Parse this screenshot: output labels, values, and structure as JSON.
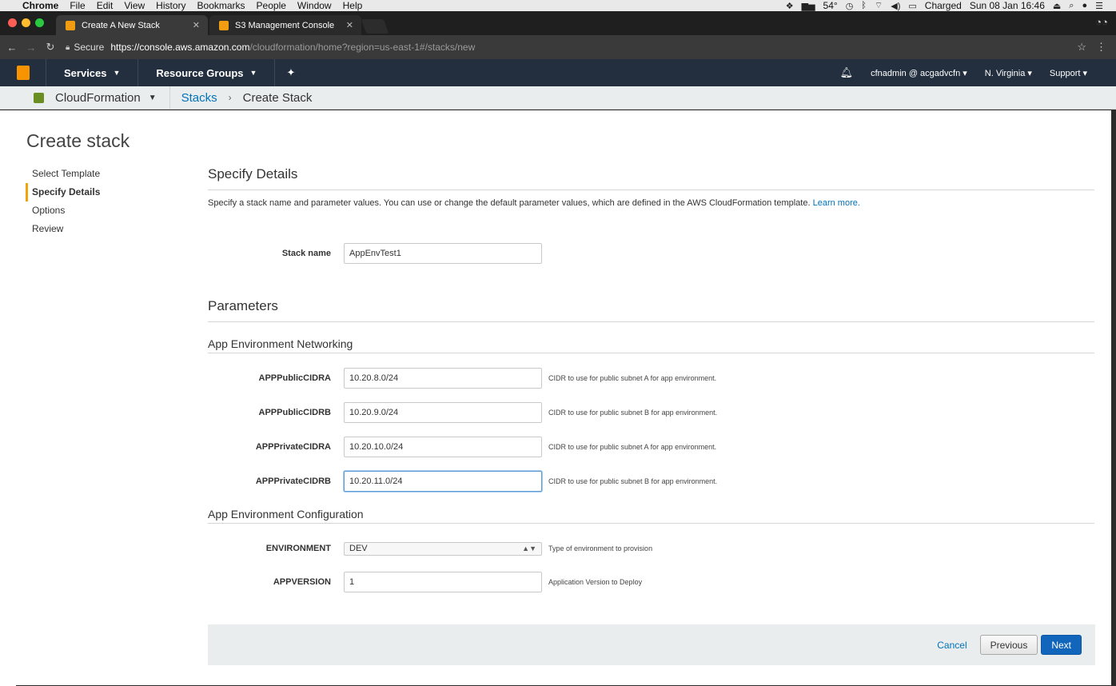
{
  "mac_menu": {
    "app": "Chrome",
    "items": [
      "File",
      "Edit",
      "View",
      "History",
      "Bookmarks",
      "People",
      "Window",
      "Help"
    ],
    "status": {
      "temp": "54°",
      "battery": "Charged",
      "datetime": "Sun 08 Jan 16:46"
    }
  },
  "tabs": [
    {
      "title": "Create A New Stack",
      "active": true
    },
    {
      "title": "S3 Management Console",
      "active": false
    }
  ],
  "address": {
    "secure_label": "Secure",
    "url_host": "https://console.aws.amazon.com",
    "url_path": "/cloudformation/home?region=us-east-1#/stacks/new"
  },
  "aws_header": {
    "services": "Services",
    "resource_groups": "Resource Groups",
    "account": "cfnadmin @ acgadvcfn",
    "region": "N. Virginia",
    "support": "Support"
  },
  "breadcrumb": {
    "service": "CloudFormation",
    "stacks": "Stacks",
    "current": "Create Stack"
  },
  "page": {
    "title": "Create stack",
    "steps": [
      "Select Template",
      "Specify Details",
      "Options",
      "Review"
    ],
    "active_step": "Specify Details",
    "section_title": "Specify Details",
    "description": "Specify a stack name and parameter values. You can use or change the default parameter values, which are defined in the AWS CloudFormation template. ",
    "learn_more": "Learn more.",
    "stack_name_label": "Stack name",
    "stack_name_value": "AppEnvTest1",
    "parameters_title": "Parameters",
    "networking_title": "App Environment Networking",
    "config_title": "App Environment Configuration"
  },
  "networking_params": [
    {
      "label": "APPPublicCIDRA",
      "value": "10.20.8.0/24",
      "help": "CIDR to use for public subnet A for app environment."
    },
    {
      "label": "APPPublicCIDRB",
      "value": "10.20.9.0/24",
      "help": "CIDR to use for public subnet B for app environment."
    },
    {
      "label": "APPPrivateCIDRA",
      "value": "10.20.10.0/24",
      "help": "CIDR to use for public subnet A for app environment."
    },
    {
      "label": "APPPrivateCIDRB",
      "value": "10.20.11.0/24",
      "help": "CIDR to use for public subnet B for app environment."
    }
  ],
  "config_params": {
    "environment": {
      "label": "ENVIRONMENT",
      "value": "DEV",
      "help": "Type of environment to provision"
    },
    "appversion": {
      "label": "APPVERSION",
      "value": "1",
      "help": "Application Version to Deploy"
    }
  },
  "footer": {
    "cancel": "Cancel",
    "previous": "Previous",
    "next": "Next"
  },
  "colors": {
    "aws_header": "#232f3e",
    "link": "#0073bb",
    "primary_button": "#1166bb",
    "active_step_marker": "#f0a30a"
  }
}
